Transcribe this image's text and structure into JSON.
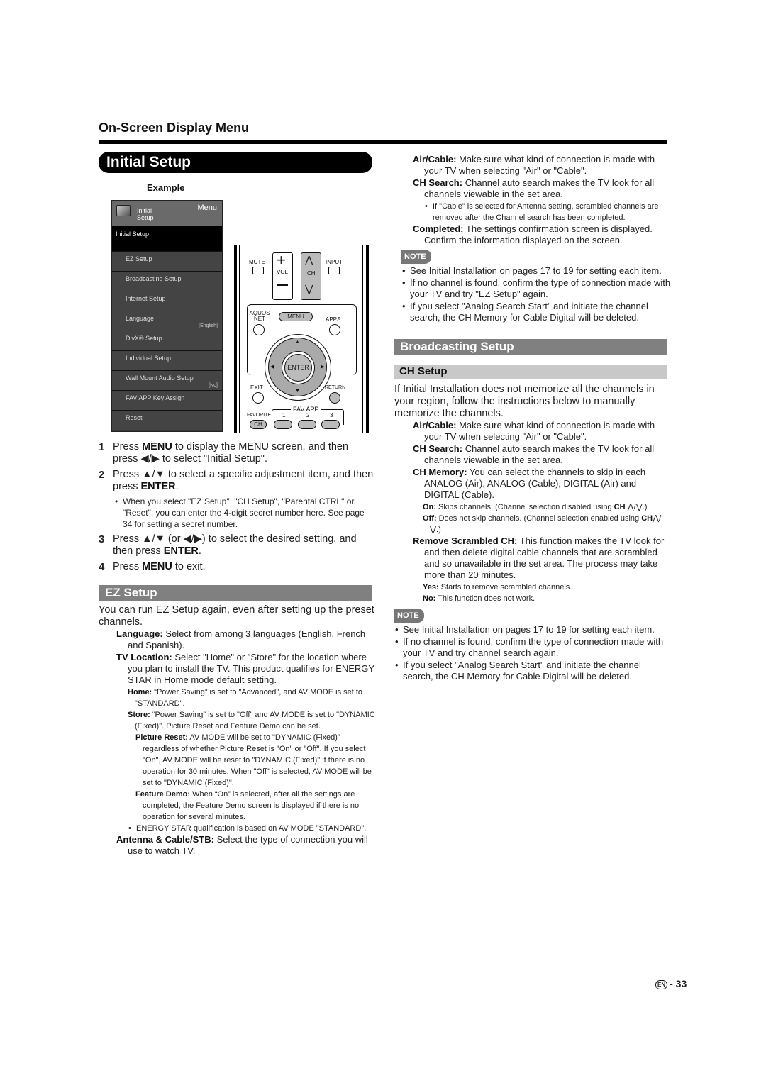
{
  "header": {
    "section_title": "On-Screen Display Menu",
    "page_title": "Initial Setup"
  },
  "example": {
    "label": "Example",
    "menu": {
      "header_title": "Initial\nSetup",
      "header_menu_label": "Menu",
      "selected": "Initial Setup",
      "items": [
        {
          "label": "EZ Setup",
          "value": ""
        },
        {
          "label": "Broadcasting Setup",
          "value": ""
        },
        {
          "label": "Internet Setup",
          "value": ""
        },
        {
          "label": "Language",
          "value": "[English]"
        },
        {
          "label": "DivX® Setup",
          "value": ""
        },
        {
          "label": "Individual Setup",
          "value": ""
        },
        {
          "label": "Wall Mount Audio Setup",
          "value": "[No]"
        },
        {
          "label": "FAV APP Key Assign",
          "value": ""
        },
        {
          "label": "Reset",
          "value": ""
        }
      ]
    },
    "remote": {
      "mute": "MUTE",
      "vol": "VOL",
      "ch": "CH",
      "input": "INPUT",
      "aquos_net": "AQUOS NET",
      "menu": "MENU",
      "apps": "APPS",
      "enter": "ENTER",
      "exit": "EXIT",
      "return": "RETURN",
      "favorite": "FAVORITE",
      "fav_ch": "CH",
      "fav_app": "FAV APP",
      "fav_1": "1",
      "fav_2": "2",
      "fav_3": "3"
    }
  },
  "steps": [
    {
      "num": "1",
      "pre": "Press ",
      "bold": "MENU",
      "post": " to display the MENU screen, and then press ◀/▶ to select \"Initial Setup\"."
    },
    {
      "num": "2",
      "pre": "Press ▲/▼ to select a specific adjustment item, and then press ",
      "bold": "ENTER",
      "post": ".",
      "sub": "When you select \"EZ Setup\", \"CH Setup\", \"Parental CTRL\" or \"Reset\", you can enter the 4-digit secret number here. See page 34 for setting a secret number."
    },
    {
      "num": "3",
      "pre": "Press ▲/▼ (or ◀/▶) to select the desired setting, and then press ",
      "bold": "ENTER",
      "post": "."
    },
    {
      "num": "4",
      "pre": "Press ",
      "bold": "MENU",
      "post": " to exit."
    }
  ],
  "ez_setup": {
    "title": "EZ Setup",
    "intro": "You can run EZ Setup again, even after setting up the preset channels.",
    "language_term": "Language:",
    "language_desc": " Select from among 3 languages (English, French and Spanish).",
    "tvloc_term": "TV Location:",
    "tvloc_desc": " Select \"Home\" or \"Store\" for the location where you plan to install the TV. This product qualifies for ENERGY STAR in Home mode default setting.",
    "home_term": "Home:",
    "home_desc": " “Power Saving” is set to \"Advanced\", and AV MODE is set to \"STANDARD\".",
    "store_term": "Store:",
    "store_desc": " “Power Saving” is set to \"Off\" and AV MODE is set to \"DYNAMIC (Fixed)\". Picture Reset and Feature Demo can be set.",
    "picreset_term": "Picture Reset:",
    "picreset_desc": " AV MODE will be set to \"DYNAMIC (Fixed)\" regardless of whether Picture Reset is \"On\" or \"Off\". If you select \"On\", AV MODE will be reset to \"DYNAMIC (Fixed)\" if there is no operation for 30 minutes. When \"Off\" is selected, AV MODE will be set to \"DYNAMIC (Fixed)\".",
    "demo_term": "Feature Demo:",
    "demo_desc": " When “On” is selected, after all the settings are completed, the Feature Demo screen is displayed if there is no operation for several minutes.",
    "energy_note": "ENERGY STAR qualification is based on AV MODE \"STANDARD\".",
    "antenna_term": "Antenna & Cable/STB:",
    "antenna_desc": " Select the type of connection you will use to watch TV.",
    "aircable_term": "Air/Cable:",
    "aircable_desc": " Make sure what kind of connection is made with your TV when selecting \"Air\" or \"Cable\".",
    "chsearch_term": "CH Search:",
    "chsearch_desc": " Channel auto search makes the TV look for all channels viewable in the set area.",
    "cable_note": "If \"Cable\" is selected for Antenna setting, scrambled channels are removed after the Channel search has been completed.",
    "completed_term": "Completed:",
    "completed_desc": " The settings confirmation screen is displayed. Confirm the information displayed on the screen.",
    "note_label": "NOTE",
    "notes": [
      "See Initial Installation on pages 17 to 19 for setting each item.",
      "If no channel is found, confirm the type of connection made with your TV and try \"EZ Setup\" again.",
      "If you select \"Analog Search Start\" and initiate the channel search, the CH Memory for Cable Digital will be deleted."
    ]
  },
  "broadcasting": {
    "title": "Broadcasting Setup",
    "ch_setup_title": "CH Setup",
    "intro": "If Initial Installation does not memorize all the channels in your region, follow the instructions below to manually memorize the channels.",
    "aircable_term": "Air/Cable:",
    "aircable_desc": " Make sure what kind of connection is made with your TV when selecting \"Air\" or \"Cable\".",
    "chsearch_term": "CH Search:",
    "chsearch_desc": " Channel auto search makes the TV look for all channels viewable in the set area.",
    "chmem_term": "CH Memory:",
    "chmem_desc": " You can select the channels to skip in each ANALOG (Air), ANALOG (Cable), DIGITAL (Air) and DIGITAL (Cable).",
    "on_term": "On:",
    "on_desc": " Skips channels. (Channel selection disabled using ",
    "on_ch": "CH",
    "on_tail": " ⋀/⋁.)",
    "off_term": "Off:",
    "off_desc": " Does not skip channels. (Channel selection enabled using ",
    "off_ch": "CH",
    "off_tail": "⋀/⋁.)",
    "rsc_term": "Remove Scrambled CH:",
    "rsc_desc": " This function makes the TV look for and then delete digital cable channels that are scrambled and so unavailable in the set area. The process may take more than 20 minutes.",
    "yes_term": "Yes:",
    "yes_desc": " Starts to remove scrambled channels.",
    "no_term": "No:",
    "no_desc": " This function does not work.",
    "note_label": "NOTE",
    "notes": [
      "See Initial Installation on pages 17 to 19 for setting each item.",
      "If no channel is found, confirm the type of connection made with your TV and try channel search again.",
      "If you select \"Analog Search Start\" and initiate the channel search, the CH Memory for Cable Digital will be deleted."
    ]
  },
  "footer": {
    "lang_badge": "EN",
    "page_number": "- 33"
  }
}
